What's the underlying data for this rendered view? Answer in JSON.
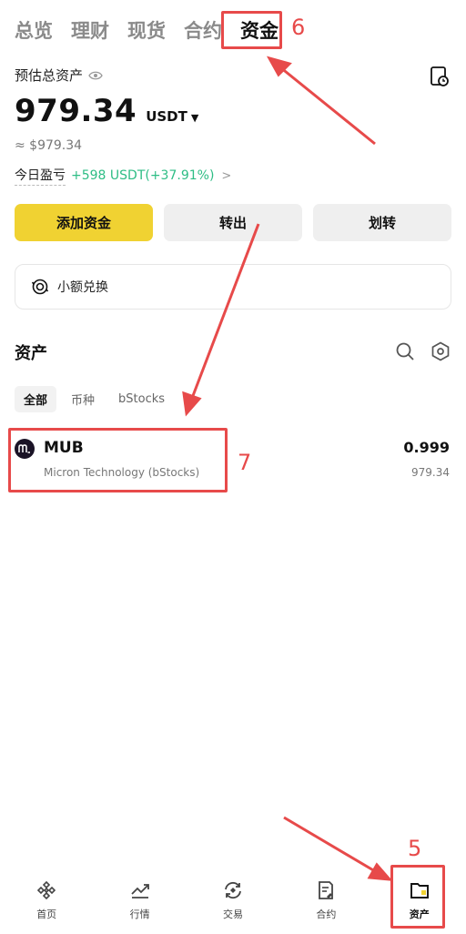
{
  "top_tabs": [
    "总览",
    "理财",
    "现货",
    "合约",
    "资金"
  ],
  "asset": {
    "label": "预估总资产",
    "value": "979.34",
    "unit": "USDT",
    "approx": "≈ $979.34",
    "pnl_label": "今日盈亏",
    "pnl_value": "+598 USDT(+37.91%)"
  },
  "actions": {
    "add": "添加资金",
    "withdraw": "转出",
    "transfer": "划转"
  },
  "small_convert": "小额兑换",
  "assets_section": {
    "title": "资产",
    "filters": [
      "全部",
      "币种",
      "bStocks"
    ],
    "rows": [
      {
        "symbol": "MUB",
        "name": "Micron Technology (bStocks)",
        "qty": "0.999",
        "value": "979.34"
      }
    ]
  },
  "bottom_nav": [
    "首页",
    "行情",
    "交易",
    "合约",
    "资产"
  ],
  "annotations": [
    "6",
    "7",
    "5"
  ],
  "colors": {
    "accent": "#f0d232",
    "positive": "#2ebd85",
    "annotation": "#e74a4a"
  }
}
